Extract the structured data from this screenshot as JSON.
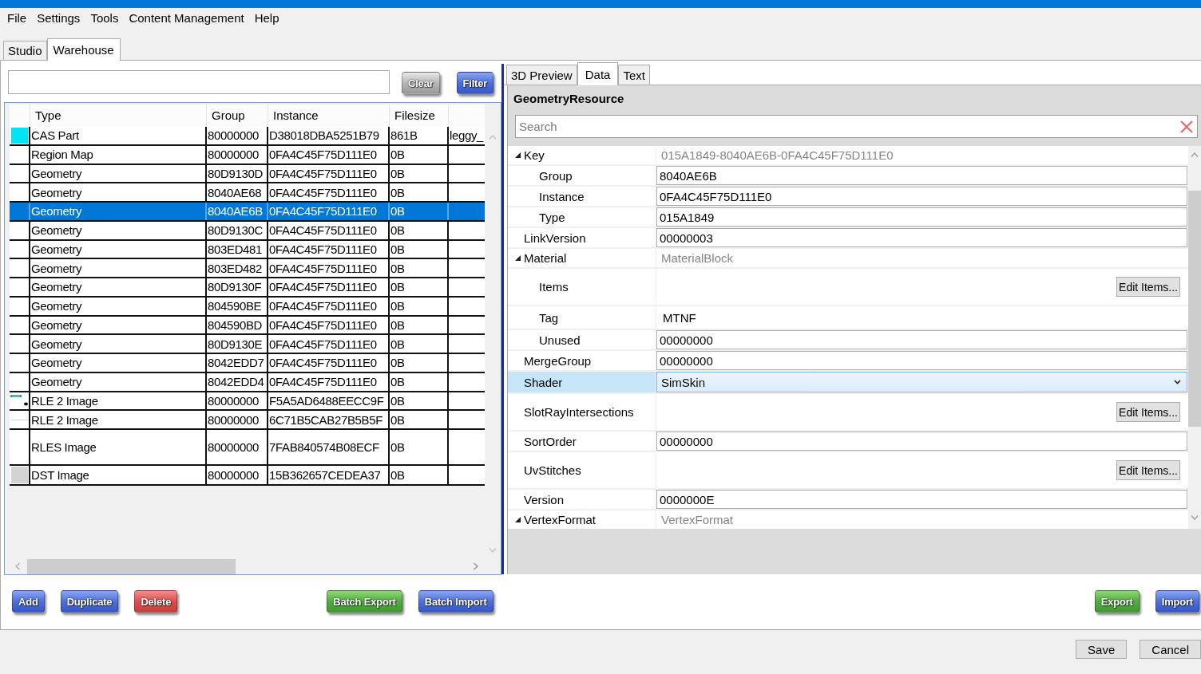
{
  "menu": [
    "File",
    "Settings",
    "Tools",
    "Content Management",
    "Help"
  ],
  "tabs": [
    {
      "label": "Studio",
      "selected": false
    },
    {
      "label": "Warehouse",
      "selected": true
    }
  ],
  "filter": {
    "buttons": [
      {
        "label": "Clear",
        "kind": "neutral"
      },
      {
        "label": "Filter",
        "kind": "default"
      }
    ]
  },
  "table": {
    "columns": [
      "Type",
      "Group",
      "Instance",
      "Filesize"
    ],
    "rows": [
      {
        "kind": "swatch",
        "selected": false,
        "type": "CAS Part",
        "group": "80000000",
        "instance": "D38018DBA5251B79",
        "filesize": "861B",
        "column_5": "leggy_"
      },
      {
        "kind": "plain",
        "selected": false,
        "type": "Region Map",
        "group": "80000000",
        "instance": "0FA4C45F75D111E0",
        "filesize": "0B"
      },
      {
        "kind": "plain",
        "selected": false,
        "type": "Geometry",
        "group": "80D9130D",
        "instance": "0FA4C45F75D111E0",
        "filesize": "0B"
      },
      {
        "kind": "plain",
        "selected": false,
        "type": "Geometry",
        "group": "8040AE68",
        "instance": "0FA4C45F75D111E0",
        "filesize": "0B"
      },
      {
        "kind": "plain",
        "selected": true,
        "type": "Geometry",
        "group": "8040AE6B",
        "instance": "0FA4C45F75D111E0",
        "filesize": "0B"
      },
      {
        "kind": "plain",
        "selected": false,
        "type": "Geometry",
        "group": "80D9130C",
        "instance": "0FA4C45F75D111E0",
        "filesize": "0B"
      },
      {
        "kind": "plain",
        "selected": false,
        "type": "Geometry",
        "group": "803ED481",
        "instance": "0FA4C45F75D111E0",
        "filesize": "0B"
      },
      {
        "kind": "plain",
        "selected": false,
        "type": "Geometry",
        "group": "803ED482",
        "instance": "0FA4C45F75D111E0",
        "filesize": "0B"
      },
      {
        "kind": "plain",
        "selected": false,
        "type": "Geometry",
        "group": "80D9130F",
        "instance": "0FA4C45F75D111E0",
        "filesize": "0B"
      },
      {
        "kind": "plain",
        "selected": false,
        "type": "Geometry",
        "group": "804590BE",
        "instance": "0FA4C45F75D111E0",
        "filesize": "0B"
      },
      {
        "kind": "plain",
        "selected": false,
        "type": "Geometry",
        "group": "804590BD",
        "instance": "0FA4C45F75D111E0",
        "filesize": "0B"
      },
      {
        "kind": "plain",
        "selected": false,
        "type": "Geometry",
        "group": "80D9130E",
        "instance": "0FA4C45F75D111E0",
        "filesize": "0B"
      },
      {
        "kind": "plain",
        "selected": false,
        "type": "Geometry",
        "group": "8042EDD7",
        "instance": "0FA4C45F75D111E0",
        "filesize": "0B"
      },
      {
        "kind": "plain",
        "selected": false,
        "type": "Geometry",
        "group": "8042EDD4",
        "instance": "0FA4C45F75D111E0",
        "filesize": "0B"
      },
      {
        "kind": "strip",
        "selected": false,
        "type": "RLE 2 Image",
        "group": "80000000",
        "instance": "F5A5AD6488EECC9F",
        "filesize": "0B"
      },
      {
        "kind": "line",
        "selected": false,
        "type": "RLE 2 Image",
        "group": "80000000",
        "instance": "6C71B5CAB27B5B5F",
        "filesize": "0B"
      },
      {
        "kind": "tall",
        "selected": false,
        "type": "RLES Image",
        "group": "80000000",
        "instance": "7FAB840574B08ECF",
        "filesize": "0B"
      },
      {
        "kind": "tile",
        "selected": false,
        "type": "DST Image",
        "group": "80000000",
        "instance": "15B362657CEDEA37",
        "filesize": "0B"
      }
    ]
  },
  "preview": {
    "tabs": [
      {
        "label": "3D Preview",
        "selected": false
      },
      {
        "label": "Data",
        "selected": true
      },
      {
        "label": "Text",
        "selected": false
      }
    ],
    "title": "GeometryResource",
    "search": {
      "placeholder": "Search"
    },
    "properties": [
      {
        "label": "Key",
        "kind": "group",
        "value": "015A1849-8040AE6B-0FA4C45F75D111E0",
        "expanded": true,
        "selected": false,
        "children": [
          {
            "label": "Group",
            "kind": "field",
            "value": "8040AE6B",
            "selected": false
          },
          {
            "label": "Instance",
            "kind": "field",
            "value": "0FA4C45F75D111E0",
            "selected": false
          },
          {
            "label": "Type",
            "kind": "field",
            "value": "015A1849",
            "selected": false
          }
        ]
      },
      {
        "label": "LinkVersion",
        "kind": "field",
        "value": "00000003",
        "selected": false
      },
      {
        "label": "Material",
        "kind": "group",
        "value": "MaterialBlock",
        "expanded": true,
        "selected": false,
        "children": [
          {
            "label": "Items",
            "kind": "button",
            "button": "Edit Items...",
            "selected": false
          },
          {
            "label": "Tag",
            "kind": "text",
            "value": "MTNF",
            "selected": false
          },
          {
            "label": "Unused",
            "kind": "field",
            "value": "00000000",
            "selected": false
          }
        ]
      },
      {
        "label": "MergeGroup",
        "kind": "field",
        "value": "00000000",
        "selected": false
      },
      {
        "label": "Shader",
        "kind": "dropdown",
        "value": "SimSkin",
        "selected": true
      },
      {
        "label": "SlotRayIntersections",
        "kind": "button",
        "button": "Edit Items...",
        "selected": false
      },
      {
        "label": "SortOrder",
        "kind": "field",
        "value": "00000000",
        "selected": false
      },
      {
        "label": "UvStitches",
        "kind": "button",
        "button": "Edit Items...",
        "selected": false
      },
      {
        "label": "Version",
        "kind": "field",
        "value": "0000000E",
        "selected": false
      },
      {
        "label": "VertexFormat",
        "kind": "group",
        "value": "VertexFormat",
        "expanded": true,
        "selected": false
      }
    ]
  },
  "action_groups": [
    {
      "buttons": [
        {
          "label": "Add",
          "kind": "default"
        },
        {
          "label": "Duplicate",
          "kind": "default"
        },
        {
          "label": "Delete",
          "kind": "danger"
        }
      ]
    },
    {
      "buttons": [
        {
          "label": "Batch Export",
          "kind": "export"
        },
        {
          "label": "Batch Import",
          "kind": "default"
        }
      ]
    },
    {
      "buttons": [
        {
          "label": "Export",
          "kind": "export"
        },
        {
          "label": "Import",
          "kind": "default"
        }
      ]
    }
  ],
  "dialog_buttons": [
    "Save",
    "Cancel"
  ]
}
